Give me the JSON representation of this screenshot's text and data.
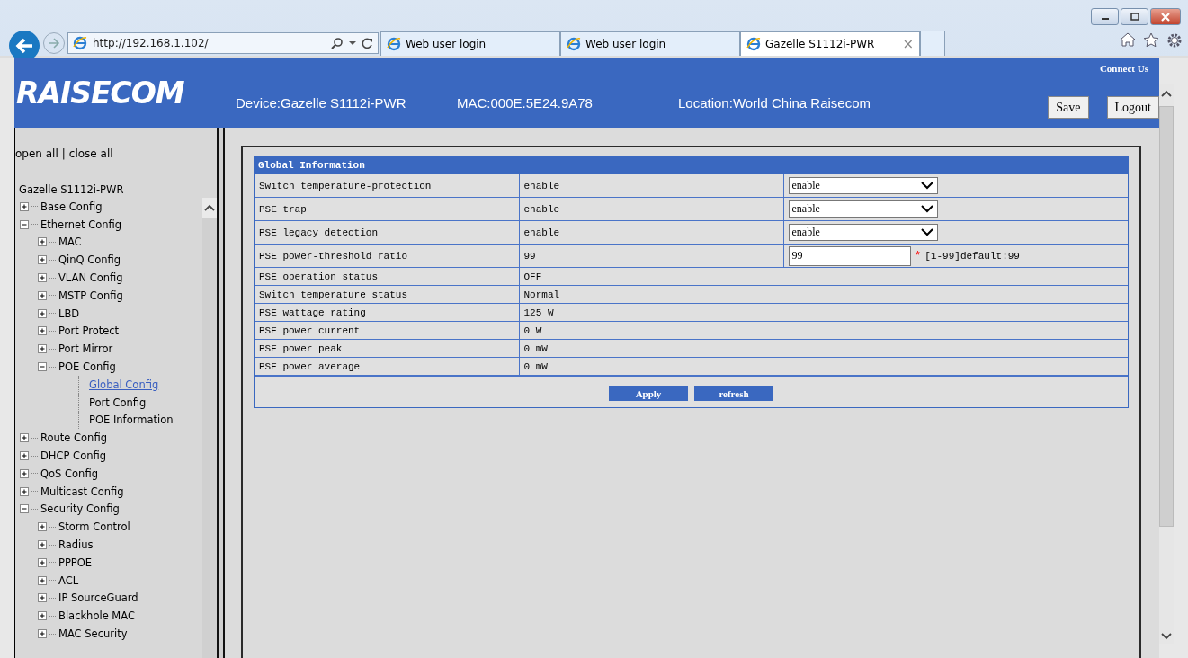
{
  "browser": {
    "address": "http://192.168.1.102/",
    "tabs": [
      {
        "title": "Web user login",
        "selected": false
      },
      {
        "title": "Web user login",
        "selected": false
      },
      {
        "title": "Gazelle S1112i-PWR",
        "selected": true
      }
    ],
    "close_tab": "×"
  },
  "header": {
    "logo": "RAISECOM",
    "device": "Device:Gazelle S1112i-PWR",
    "mac": "MAC:000E.5E24.9A78",
    "location": "Location:World China Raisecom",
    "connect": "Connect Us",
    "buttons": [
      "Save",
      "Logout"
    ]
  },
  "sidebar": {
    "open_all": "open all",
    "separator": "|",
    "close_all": "close all",
    "tree": {
      "label": "Gazelle S1112i-PWR",
      "children": [
        {
          "label": "Base Config",
          "kind": "folder",
          "expanded": false
        },
        {
          "label": "Ethernet Config",
          "kind": "folder",
          "expanded": true,
          "children": [
            {
              "label": "MAC",
              "kind": "folder",
              "expanded": false
            },
            {
              "label": "QinQ Config",
              "kind": "folder",
              "expanded": false
            },
            {
              "label": "VLAN Config",
              "kind": "folder",
              "expanded": false
            },
            {
              "label": "MSTP Config",
              "kind": "folder",
              "expanded": false
            },
            {
              "label": "LBD",
              "kind": "folder",
              "expanded": false
            },
            {
              "label": "Port Protect",
              "kind": "folder",
              "expanded": false
            },
            {
              "label": "Port Mirror",
              "kind": "folder",
              "expanded": false
            },
            {
              "label": "POE Config",
              "kind": "folder",
              "expanded": true,
              "children": [
                {
                  "label": "Global Config",
                  "kind": "page",
                  "selected": true
                },
                {
                  "label": "Port Config",
                  "kind": "page",
                  "selected": false
                },
                {
                  "label": "POE Information",
                  "kind": "page",
                  "selected": false
                }
              ]
            }
          ]
        },
        {
          "label": "Route Config",
          "kind": "folder",
          "expanded": false
        },
        {
          "label": "DHCP Config",
          "kind": "folder",
          "expanded": false
        },
        {
          "label": "QoS Config",
          "kind": "folder",
          "expanded": false
        },
        {
          "label": "Multicast Config",
          "kind": "folder",
          "expanded": false
        },
        {
          "label": "Security Config",
          "kind": "folder",
          "expanded": true,
          "children": [
            {
              "label": "Storm Control",
              "kind": "folder",
              "expanded": false
            },
            {
              "label": "Radius",
              "kind": "folder",
              "expanded": false
            },
            {
              "label": "PPPOE",
              "kind": "folder",
              "expanded": false
            },
            {
              "label": "ACL",
              "kind": "folder",
              "expanded": false
            },
            {
              "label": "IP SourceGuard",
              "kind": "folder",
              "expanded": false
            },
            {
              "label": "Blackhole MAC",
              "kind": "folder",
              "expanded": false
            },
            {
              "label": "MAC Security",
              "kind": "folder",
              "expanded": false
            }
          ]
        }
      ]
    }
  },
  "panel": {
    "title": "Global Information",
    "rows": [
      {
        "kind": "select",
        "label": "Switch temperature-protection",
        "value": "enable",
        "choice": "enable"
      },
      {
        "kind": "select",
        "label": "PSE trap",
        "value": "enable",
        "choice": "enable"
      },
      {
        "kind": "select",
        "label": "PSE legacy detection",
        "value": "enable",
        "choice": "enable"
      },
      {
        "kind": "input",
        "label": "PSE power-threshold ratio",
        "value": "99",
        "input": "99",
        "required": "*",
        "hint": "[1-99]default:99"
      },
      {
        "kind": "text",
        "label": "PSE operation status",
        "value": "OFF"
      },
      {
        "kind": "text",
        "label": "Switch temperature status",
        "value": "Normal"
      },
      {
        "kind": "text",
        "label": "PSE wattage rating",
        "value": "125 W"
      },
      {
        "kind": "text",
        "label": "PSE power current",
        "value": "0 W"
      },
      {
        "kind": "text",
        "label": "PSE power peak",
        "value": "0 mW"
      },
      {
        "kind": "text",
        "label": "PSE power average",
        "value": "0 mW"
      }
    ],
    "buttons": [
      "Apply",
      "refresh"
    ]
  }
}
